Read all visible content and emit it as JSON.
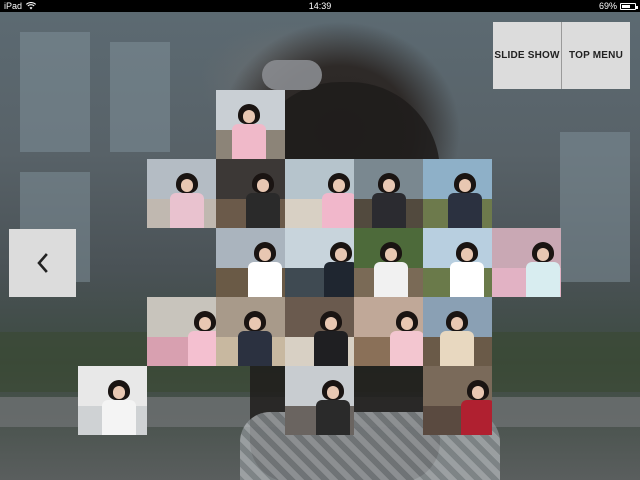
{
  "statusbar": {
    "device": "iPad",
    "time": "14:39",
    "battery": "69%",
    "battery_level": 0.69
  },
  "buttons": {
    "slideshow": "SLIDE SHOW",
    "topmenu": "TOP MENU"
  },
  "icons": {
    "back": "chevron-left-icon",
    "wifi": "wifi-icon",
    "battery": "battery-icon"
  },
  "colors": {
    "button_bg": "#dcdcdc",
    "button_text": "#222222",
    "status_bar": "#000000"
  },
  "thumbnails": [
    {
      "bg": "#c9cfd4",
      "floor": "#8c8478",
      "top": "#f0b9c9"
    },
    {
      "bg": "#b4bcc4",
      "floor": "#c0b8b0",
      "top": "#e9c2cf"
    },
    {
      "bg": "#3c3836",
      "floor": "#6b5a4a",
      "top": "#2a2a2a"
    },
    {
      "bg": "#b6c4cc",
      "floor": "#d8d0c4",
      "top": "#f1b7cb"
    },
    {
      "bg": "#7a8890",
      "floor": "#524a3e",
      "top": "#2b2b30"
    },
    {
      "bg": "#8eb0c8",
      "floor": "#6d7a4c",
      "top": "#2b3140"
    },
    {
      "bg": "#aab4be",
      "floor": "#6a5a46",
      "top": "#ffffff"
    },
    {
      "bg": "#c8d4dc",
      "floor": "#3f4a52",
      "top": "#1f2630"
    },
    {
      "bg": "#4d6a3a",
      "floor": "#7a6a56",
      "top": "#f1f1f1"
    },
    {
      "bg": "#b8cfe0",
      "floor": "#6a7a4a",
      "top": "#ffffff"
    },
    {
      "bg": "#c9a8b4",
      "floor": "#e2b2c4",
      "top": "#d8edf0"
    },
    {
      "bg": "#c8c4bc",
      "floor": "#d8a0b0",
      "top": "#f4c0d0"
    },
    {
      "bg": "#a89a8a",
      "floor": "#c8b8a0",
      "top": "#2b3140"
    },
    {
      "bg": "#6a5a4e",
      "floor": "#d8d0c4",
      "top": "#1f1f22"
    },
    {
      "bg": "#c0a898",
      "floor": "#8a7058",
      "top": "#f3c6d0"
    },
    {
      "bg": "#8aa0b4",
      "floor": "#6a5a48",
      "top": "#e8d8c0"
    },
    {
      "bg": "#e8e8e8",
      "floor": "#cfd2d4",
      "top": "#f4f4f4"
    },
    {
      "bg": "#c8ccd0",
      "floor": "#6a6460",
      "top": "#2a2a2a"
    },
    {
      "bg": "#7a6a5a",
      "floor": "#5a4a40",
      "top": "#b02030"
    }
  ]
}
